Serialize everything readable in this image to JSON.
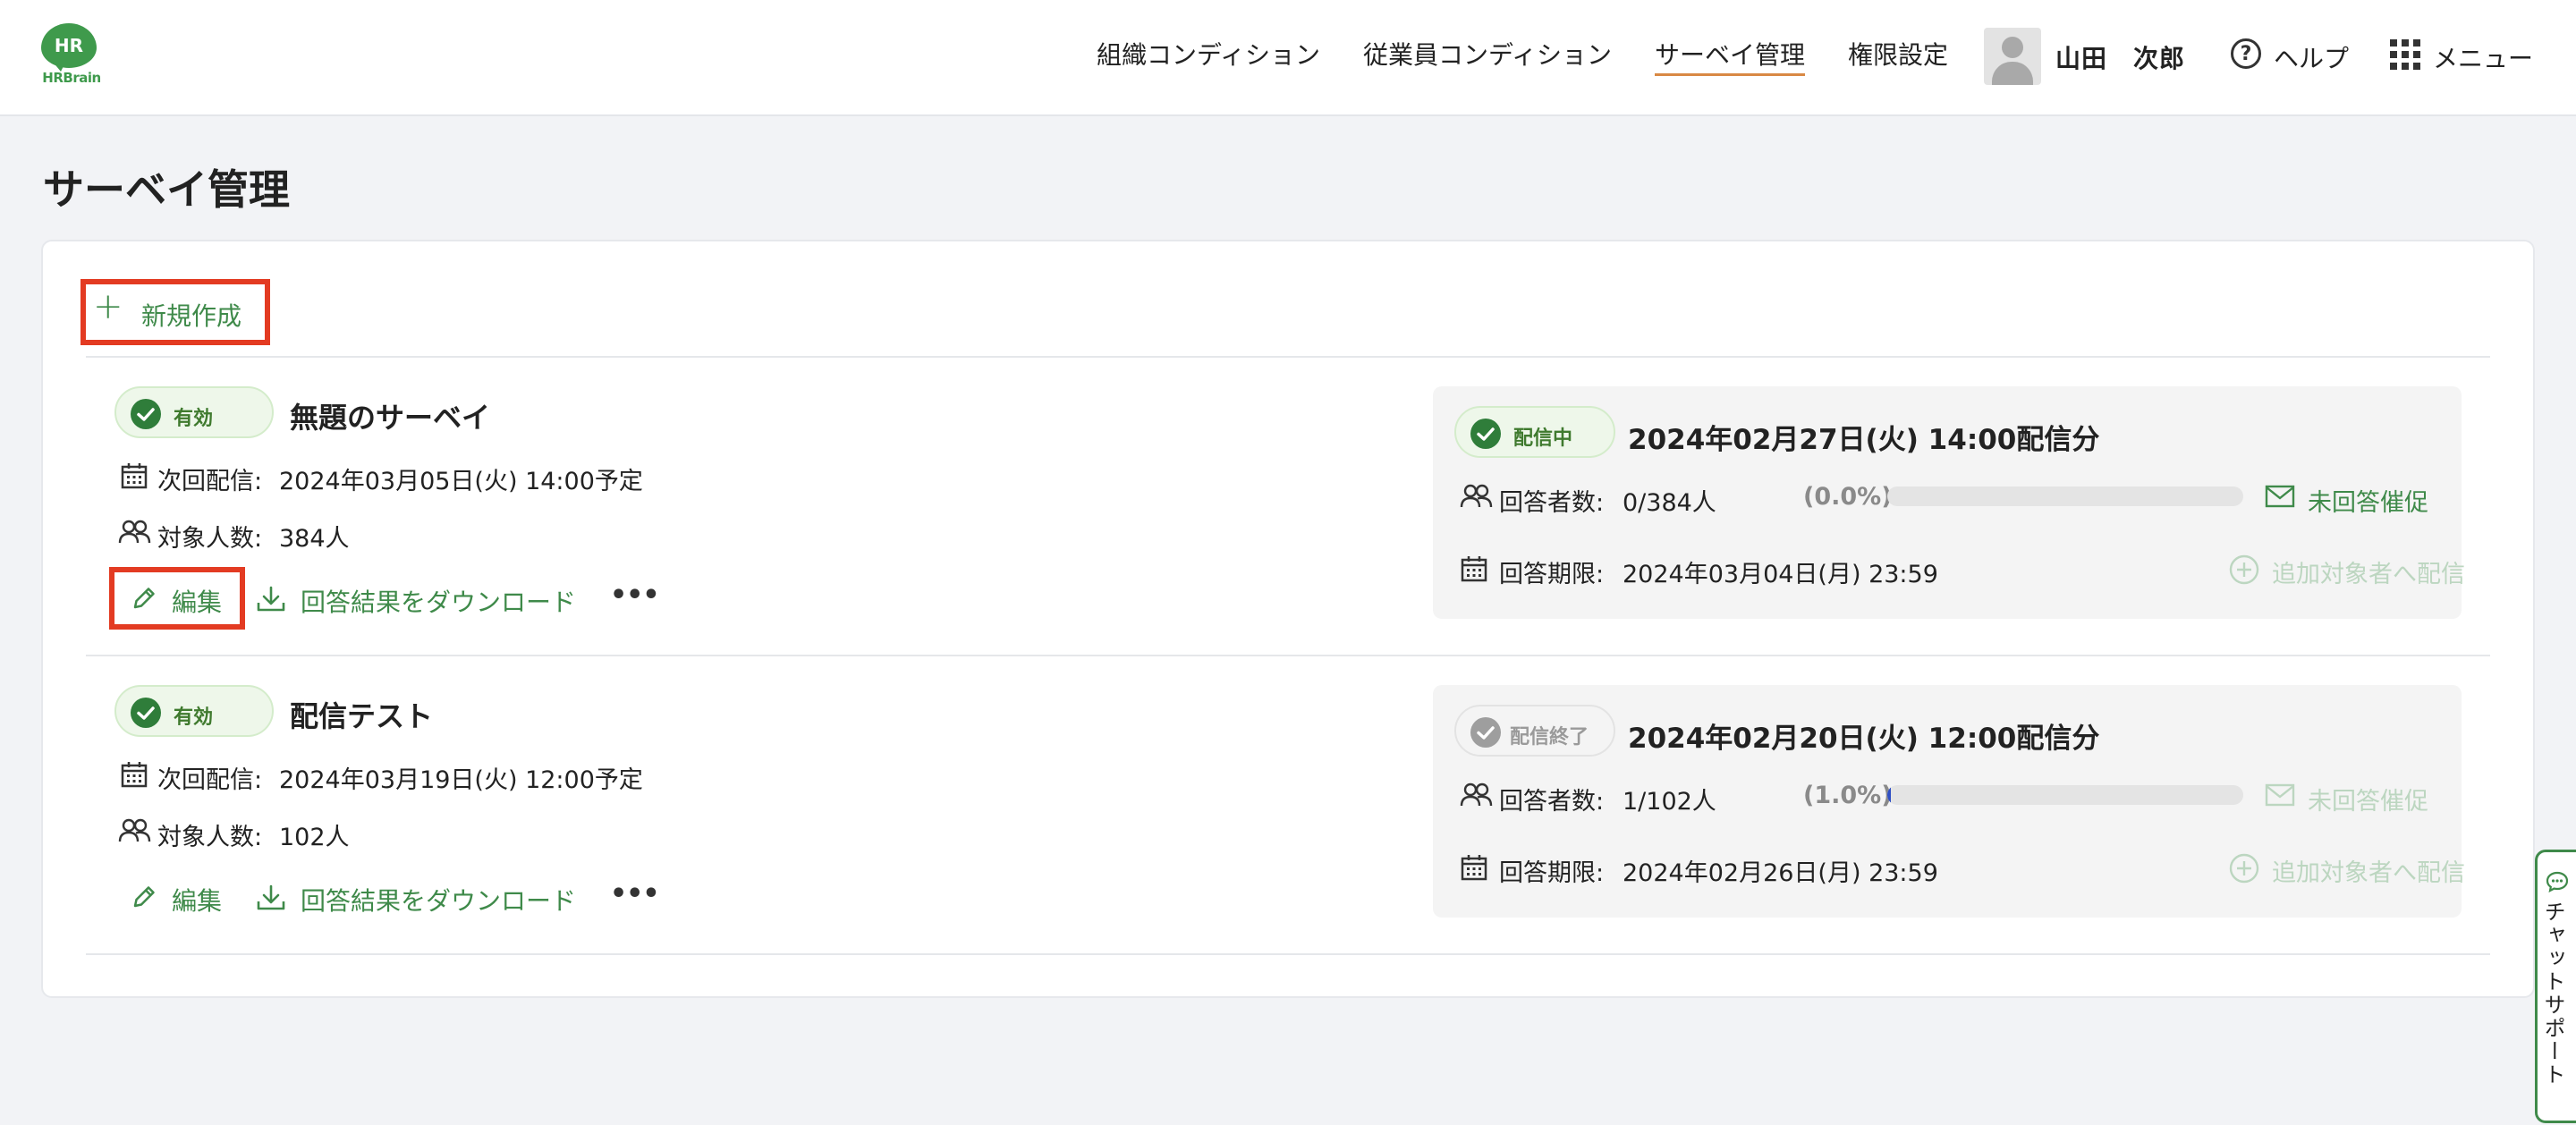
{
  "header": {
    "logo_mark": "HR",
    "logo_word": "HRBrain",
    "nav": [
      {
        "label": "組織コンディション"
      },
      {
        "label": "従業員コンディション"
      },
      {
        "label": "サーベイ管理",
        "active": true
      },
      {
        "label": "権限設定"
      }
    ],
    "user_name": "山田　次郎",
    "help_label": "ヘルプ",
    "menu_label": "メニュー"
  },
  "page": {
    "title": "サーベイ管理",
    "new_button_label": "新規作成"
  },
  "surveys": [
    {
      "status_label": "有効",
      "title": "無題のサーベイ",
      "next_label": "次回配信:",
      "next_value": "2024年03月05日(火) 14:00予定",
      "target_label": "対象人数:",
      "target_value": "384人",
      "edit_label": "編集",
      "download_label": "回答結果をダウンロード",
      "more_label": "•••",
      "delivery": {
        "status_label": "配信中",
        "title": "2024年02月27日(火) 14:00配信分",
        "respondents_label": "回答者数:",
        "respondents_value": "0/384人",
        "percent": "(0.0%)",
        "progress": 0.0,
        "remind_label": "未回答催促",
        "deadline_label": "回答期限:",
        "deadline_value": "2024年03月04日(月) 23:59",
        "add_send_label": "追加対象者へ配信"
      }
    },
    {
      "status_label": "有効",
      "title": "配信テスト",
      "next_label": "次回配信:",
      "next_value": "2024年03月19日(火) 12:00予定",
      "target_label": "対象人数:",
      "target_value": "102人",
      "edit_label": "編集",
      "download_label": "回答結果をダウンロード",
      "more_label": "•••",
      "delivery": {
        "status_label": "配信終了",
        "title": "2024年02月20日(火) 12:00配信分",
        "respondents_label": "回答者数:",
        "respondents_value": "1/102人",
        "percent": "(1.0%)",
        "progress": 0.01,
        "remind_label": "未回答催促",
        "deadline_label": "回答期限:",
        "deadline_value": "2024年02月26日(月) 23:59",
        "add_send_label": "追加対象者へ配信"
      }
    }
  ],
  "chat_support_label": "チャットサポート",
  "colors": {
    "brand_green": "#3f8a4a",
    "highlight_red": "#e33b22",
    "active_underline": "#d98944",
    "progress_blue": "#2f4fc4"
  }
}
